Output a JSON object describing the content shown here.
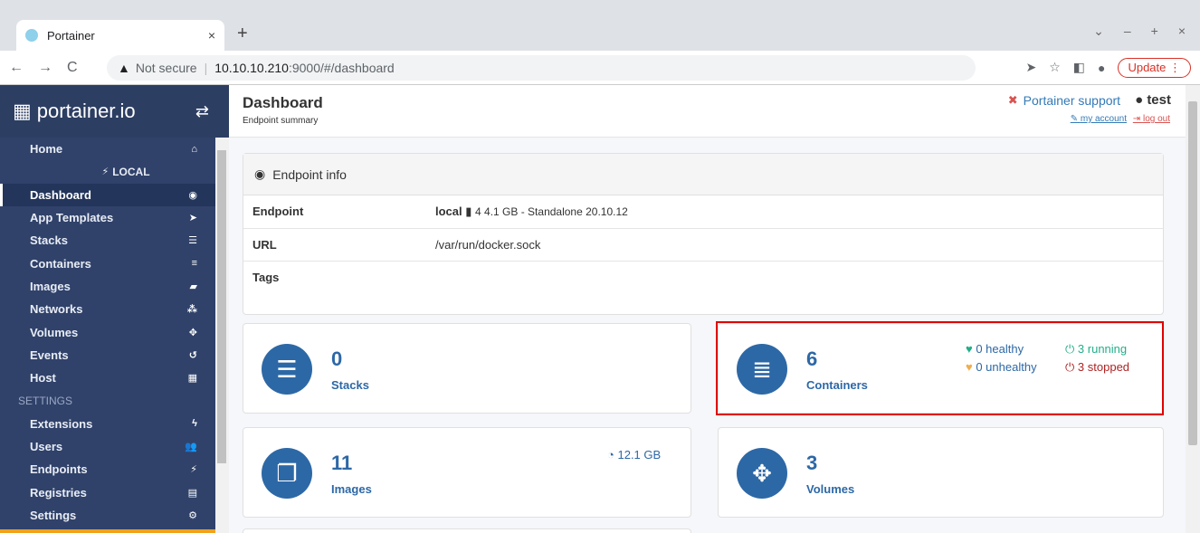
{
  "browser": {
    "tab_title": "Portainer",
    "tab_close": "×",
    "new_tab": "+",
    "win_controls": [
      "⌄",
      "–",
      "+",
      "×"
    ],
    "nav": [
      "←",
      "→",
      "C"
    ],
    "security_label": "Not secure",
    "url_host": "10.10.10.210",
    "url_path": ":9000/#/dashboard",
    "update_label": "Update"
  },
  "sidebar": {
    "brand": "portainer.io",
    "items": [
      {
        "label": "Home",
        "icon": "⌂"
      },
      {
        "label": "LOCAL",
        "icon": "⚡"
      },
      {
        "label": "Dashboard",
        "icon": "◉"
      },
      {
        "label": "App Templates",
        "icon": "➤"
      },
      {
        "label": "Stacks",
        "icon": "☰"
      },
      {
        "label": "Containers",
        "icon": "≡"
      },
      {
        "label": "Images",
        "icon": "▰"
      },
      {
        "label": "Networks",
        "icon": "⁂"
      },
      {
        "label": "Volumes",
        "icon": "✥"
      },
      {
        "label": "Events",
        "icon": "↺"
      },
      {
        "label": "Host",
        "icon": "▦"
      },
      {
        "label": "SETTINGS",
        "icon": ""
      },
      {
        "label": "Extensions",
        "icon": "ϟ"
      },
      {
        "label": "Users",
        "icon": "👥"
      },
      {
        "label": "Endpoints",
        "icon": "⚡"
      },
      {
        "label": "Registries",
        "icon": "▤"
      },
      {
        "label": "Settings",
        "icon": "⚙"
      }
    ]
  },
  "header": {
    "title": "Dashboard",
    "subtitle": "Endpoint summary",
    "support": "Portainer support",
    "user": "test",
    "my_account": "my account",
    "log_out": "log out"
  },
  "endpoint_info": {
    "title": "Endpoint info",
    "rows": {
      "endpoint_key": "Endpoint",
      "endpoint_name": "local",
      "endpoint_detail": "4  4.1 GB - Standalone 20.10.12",
      "url_key": "URL",
      "url_val": "/var/run/docker.sock",
      "tags_key": "Tags"
    }
  },
  "cards": {
    "stacks": {
      "value": "0",
      "label": "Stacks"
    },
    "containers": {
      "value": "6",
      "label": "Containers",
      "healthy": "0 healthy",
      "running": "3 running",
      "unhealthy": "0 unhealthy",
      "stopped": "3 stopped"
    },
    "images": {
      "value": "11",
      "label": "Images",
      "size": "12.1 GB"
    },
    "volumes": {
      "value": "3",
      "label": "Volumes"
    }
  },
  "colors": {
    "sidebar": "#30426a",
    "accent": "#2d68a6",
    "highlight": "#e00000"
  }
}
